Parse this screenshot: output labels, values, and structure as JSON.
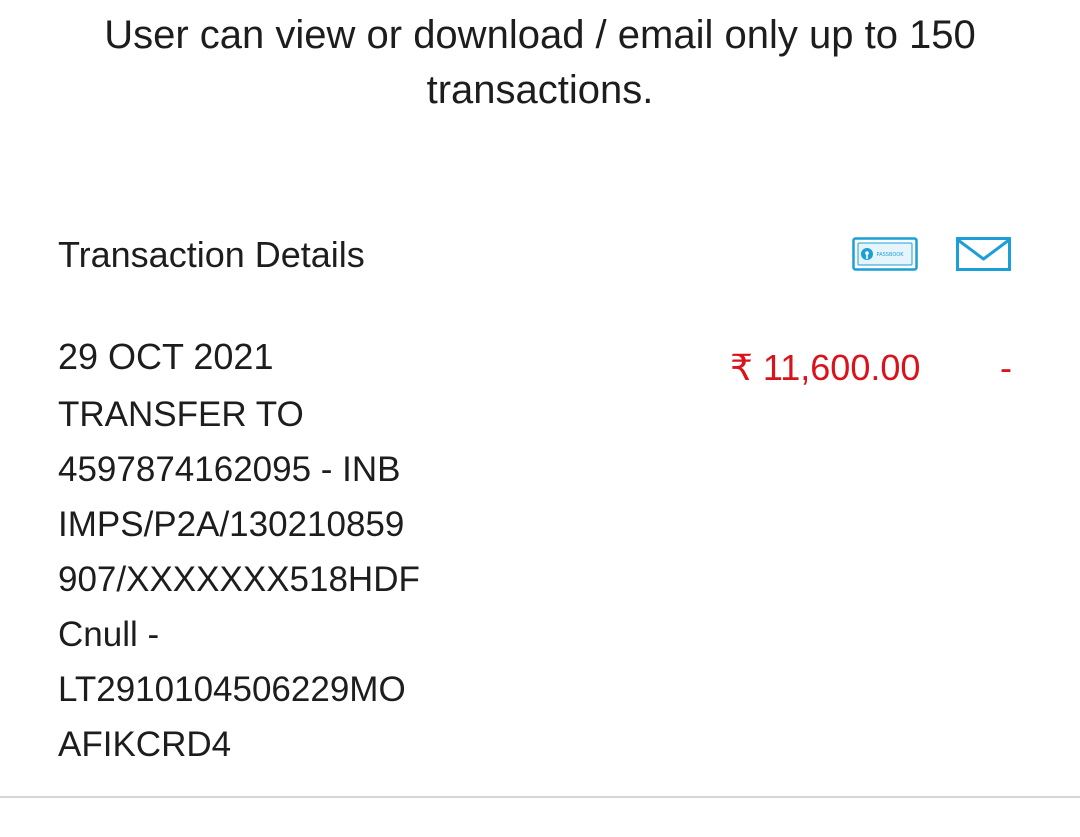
{
  "notice": {
    "text": "User can view or download / email only up to 150 transactions."
  },
  "section": {
    "title": "Transaction Details",
    "actions": {
      "passbook_icon": "passbook-icon",
      "passbook_text": "PASSBOOK",
      "mail_icon": "mail-icon"
    }
  },
  "transactions": [
    {
      "date": "29 OCT 2021",
      "description_lines": [
        "TRANSFER TO",
        "4597874162095 - INB",
        "IMPS/P2A/130210859",
        "907/XXXXXXX518HDF",
        "Cnull -",
        "LT2910104506229MO",
        "AFIKCRD4"
      ],
      "amount": "₹ 11,600.00",
      "type_indicator": "-"
    }
  ],
  "colors": {
    "text": "#1d1d1d",
    "debit": "#d9121b",
    "accent": "#1b9fd6",
    "divider": "#d6d6d6"
  }
}
